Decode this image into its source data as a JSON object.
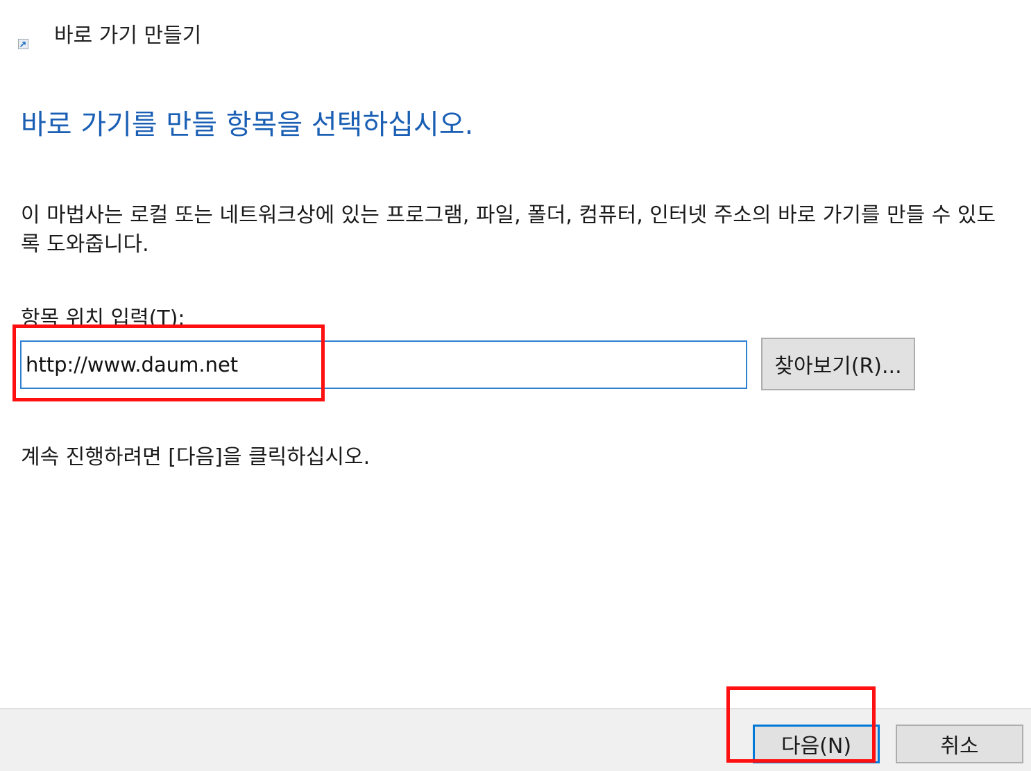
{
  "window": {
    "title": "바로 가기 만들기",
    "icon": "shortcut-icon"
  },
  "main": {
    "heading": "바로 가기를 만들 항목을 선택하십시오.",
    "description": "이 마법사는 로컬 또는 네트워크상에 있는 프로그램, 파일, 폴더, 컴퓨터, 인터넷 주소의 바로 가기를 만들 수 있도록 도와줍니다.",
    "location_label": "항목 위치 입력(T):",
    "location_value": "http://www.daum.net",
    "browse_label": "찾아보기(R)...",
    "continue_text": "계속 진행하려면 [다음]을 클릭하십시오."
  },
  "footer": {
    "next_label": "다음(N)",
    "cancel_label": "취소"
  },
  "colors": {
    "heading": "#1a5fb4",
    "accent": "#0078d7",
    "highlight": "#ff1010",
    "footer_bg": "#f0f0f0"
  }
}
